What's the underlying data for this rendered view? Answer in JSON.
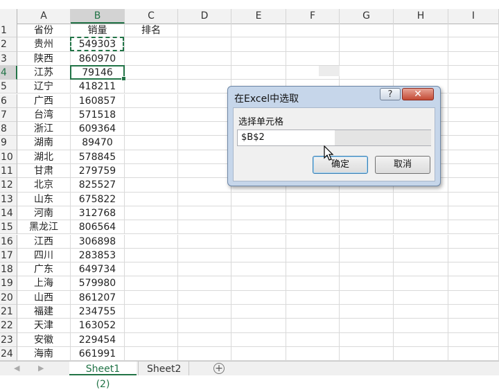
{
  "columns": [
    "A",
    "B",
    "C",
    "D",
    "E",
    "F",
    "G",
    "H",
    "I"
  ],
  "selected_column": "B",
  "selected_row": "4",
  "header_row": {
    "row": "1",
    "a": "省份",
    "b": "销量",
    "c": "排名"
  },
  "rows": [
    {
      "row": "2",
      "a": "贵州",
      "b": "549303"
    },
    {
      "row": "3",
      "a": "陕西",
      "b": "860970"
    },
    {
      "row": "4",
      "a": "江苏",
      "b": "79146"
    },
    {
      "row": "5",
      "a": "辽宁",
      "b": "418211"
    },
    {
      "row": "6",
      "a": "广西",
      "b": "160857"
    },
    {
      "row": "7",
      "a": "台湾",
      "b": "571518"
    },
    {
      "row": "8",
      "a": "浙江",
      "b": "609364"
    },
    {
      "row": "9",
      "a": "湖南",
      "b": "89470"
    },
    {
      "row": "10",
      "a": "湖北",
      "b": "578845"
    },
    {
      "row": "11",
      "a": "甘肃",
      "b": "279759"
    },
    {
      "row": "12",
      "a": "北京",
      "b": "825527"
    },
    {
      "row": "13",
      "a": "山东",
      "b": "675822"
    },
    {
      "row": "14",
      "a": "河南",
      "b": "312768"
    },
    {
      "row": "15",
      "a": "黑龙江",
      "b": "806564"
    },
    {
      "row": "16",
      "a": "江西",
      "b": "306898"
    },
    {
      "row": "17",
      "a": "四川",
      "b": "283853"
    },
    {
      "row": "18",
      "a": "广东",
      "b": "649734"
    },
    {
      "row": "19",
      "a": "上海",
      "b": "579980"
    },
    {
      "row": "20",
      "a": "山西",
      "b": "861207"
    },
    {
      "row": "21",
      "a": "福建",
      "b": "234755"
    },
    {
      "row": "22",
      "a": "天津",
      "b": "163052"
    },
    {
      "row": "23",
      "a": "安徽",
      "b": "229454"
    },
    {
      "row": "24",
      "a": "海南",
      "b": "661991"
    }
  ],
  "tabs": {
    "active": "Sheet1 (2)",
    "other": "Sheet2",
    "add": "⊕"
  },
  "dialog": {
    "title": "在Excel中选取",
    "help": "?",
    "close": "✕",
    "label": "选择单元格",
    "input_value": "$B$2",
    "ok": "确定",
    "cancel": "取消"
  },
  "colors": {
    "accent": "#217346",
    "dialog_frame": "#c6d6ea"
  }
}
